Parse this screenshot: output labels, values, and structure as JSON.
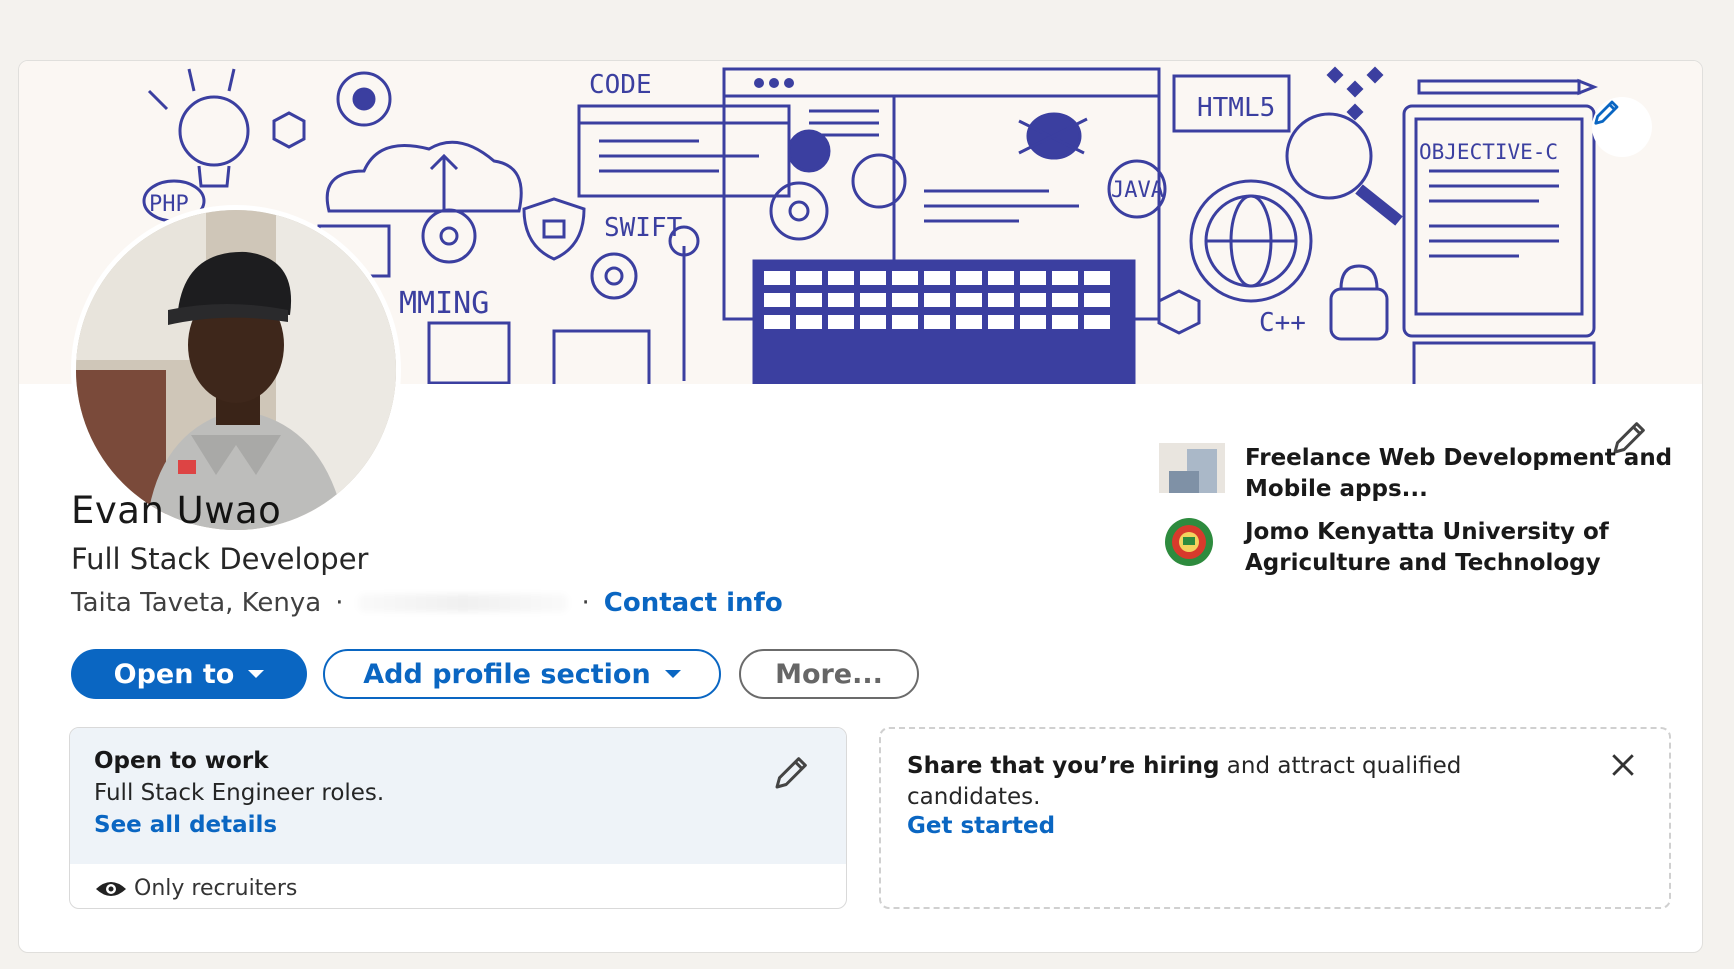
{
  "profile": {
    "name": "Evan Uwao",
    "headline": "Full Stack Developer",
    "location": "Taita Taveta, Kenya",
    "contact_info": "Contact info"
  },
  "banner": {
    "labels": [
      "CODE",
      "PHP",
      "SWIFT",
      "MMING",
      "HTML5",
      "JAVA",
      "OBJECTIVE-C",
      "C++"
    ]
  },
  "actions": {
    "open_to": "Open to",
    "add_profile_section": "Add profile section",
    "more": "More..."
  },
  "side": {
    "experience": "Freelance Web Development and Mobile apps...",
    "education": "Jomo Kenyatta University of Agriculture and Technology"
  },
  "open_to_work": {
    "title": "Open to work",
    "roles": "Full Stack Engineer roles.",
    "details_link": "See all details",
    "visibility": "Only recruiters"
  },
  "hiring": {
    "bold": "Share that you’re hiring",
    "rest": " and attract qualified candidates.",
    "link": "Get started"
  },
  "colors": {
    "accent": "#0a66c2",
    "banner_line": "#3b3fa0",
    "page_bg": "#f4f2ee"
  },
  "icons": [
    "pencil-icon",
    "caret-down-icon",
    "eye-icon",
    "close-icon"
  ]
}
